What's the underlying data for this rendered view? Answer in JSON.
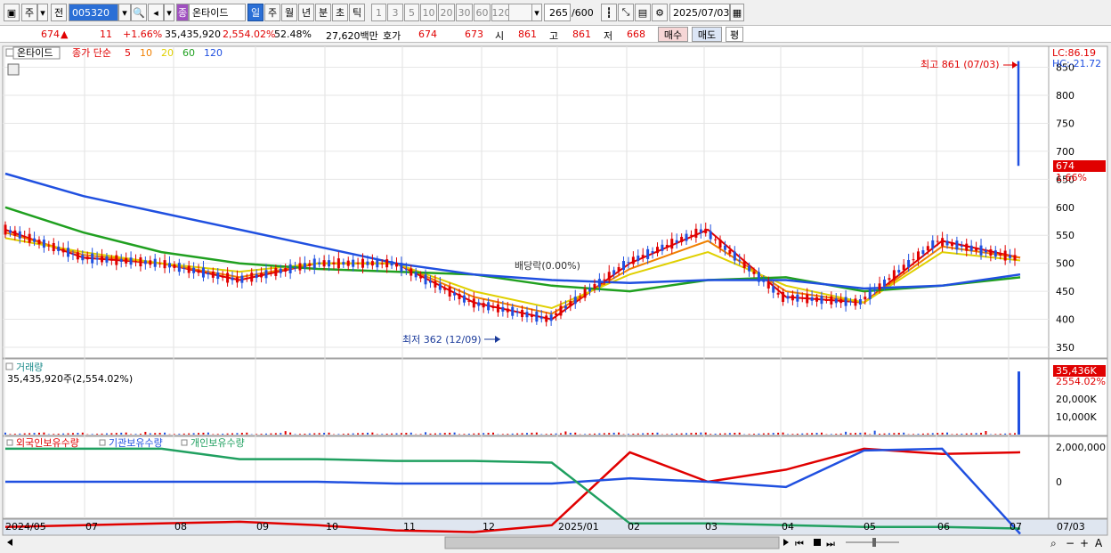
{
  "toolbar": {
    "market": "주",
    "type": "전",
    "code": "005320",
    "badge": "종",
    "name": "온타이드",
    "periods": [
      "일",
      "주",
      "월",
      "년",
      "분",
      "초",
      "틱"
    ],
    "selected_period": "일",
    "intervals": [
      "1",
      "3",
      "5",
      "10",
      "20",
      "30",
      "60",
      "120"
    ],
    "count": "265",
    "count_max": "/600",
    "date": "2025/07/03"
  },
  "quote": {
    "price": "674",
    "arrow": "▲",
    "change": "11",
    "change_pct": "+1.66%",
    "volume": "35,435,920",
    "volume_ratio": "2,554.02%",
    "turnover": "52.48%",
    "amount": "27,620백만",
    "hoga_label": "호가",
    "ask": "674",
    "bid": "673",
    "open_label": "시",
    "open": "861",
    "high_label": "고",
    "high": "861",
    "low_label": "저",
    "low": "668",
    "buy_label": "매수",
    "sell_label": "매도",
    "avg_label": "평"
  },
  "price_panel": {
    "name_tag": "온타이드",
    "legend_close": "종가 단순",
    "ma": [
      {
        "label": "5",
        "color": "#e00000"
      },
      {
        "label": "10",
        "color": "#f08000"
      },
      {
        "label": "20",
        "color": "#e0d000"
      },
      {
        "label": "60",
        "color": "#20a020"
      },
      {
        "label": "120",
        "color": "#2050e0"
      }
    ],
    "lc_label": "LC:86.19",
    "hc_label": "HC:-21.72",
    "axis_ticks": [
      "850",
      "800",
      "750",
      "700",
      "650",
      "600",
      "550",
      "500",
      "450",
      "400",
      "350"
    ],
    "high_annotation": "최고 861 (07/03)",
    "low_annotation": "최저 362 (12/09)",
    "dividend_annotation": "배당락(0.00%)",
    "last_price_box": "674",
    "last_pct": "1.66%"
  },
  "volume_panel": {
    "title": "거래량",
    "value_text": "35,435,920주(2,554.02%)",
    "box_value": "35,436K",
    "box_pct": "2554.02%",
    "axis_ticks": [
      "20,000K",
      "10,000K"
    ]
  },
  "holdings_panel": {
    "legend": [
      {
        "label": "외국인보유수량",
        "color": "#e00000"
      },
      {
        "label": "기관보유수량",
        "color": "#2050e0"
      },
      {
        "label": "개인보유수량",
        "color": "#20a060"
      }
    ],
    "axis_ticks": [
      "2,000,000",
      "0"
    ]
  },
  "x_axis": [
    "2024/05",
    "07",
    "08",
    "09",
    "10",
    "11",
    "12",
    "2025/01",
    "02",
    "03",
    "04",
    "05",
    "06",
    "07",
    "07/03"
  ],
  "colors": {
    "up": "#e00000",
    "down": "#2050e0",
    "accent": "#2b6fd6"
  },
  "chart_data": [
    {
      "type": "line",
      "title": "",
      "xlabel": "",
      "ylabel": "",
      "ylim": [
        330,
        870
      ],
      "categories": [
        "2024/05",
        "07",
        "08",
        "09",
        "10",
        "11",
        "12",
        "2025/01",
        "02",
        "03",
        "04",
        "05",
        "06",
        "07"
      ],
      "series": [
        {
          "name": "5",
          "values": [
            560,
            510,
            500,
            470,
            500,
            500,
            430,
            400,
            500,
            560,
            440,
            430,
            540,
            510
          ]
        },
        {
          "name": "10",
          "values": [
            555,
            515,
            500,
            475,
            500,
            500,
            440,
            410,
            490,
            540,
            450,
            430,
            530,
            510
          ]
        },
        {
          "name": "20",
          "values": [
            545,
            520,
            500,
            485,
            500,
            500,
            450,
            420,
            480,
            520,
            460,
            430,
            520,
            505
          ]
        },
        {
          "name": "60",
          "values": [
            600,
            555,
            520,
            500,
            490,
            485,
            480,
            460,
            450,
            470,
            475,
            450,
            460,
            475
          ]
        },
        {
          "name": "120",
          "values": [
            660,
            620,
            590,
            560,
            530,
            500,
            480,
            470,
            465,
            470,
            470,
            455,
            460,
            480
          ]
        }
      ],
      "annotations": {
        "high": 861,
        "low": 362,
        "last": 674
      }
    },
    {
      "type": "bar",
      "title": "거래량",
      "last_value": 35435920,
      "ylim": [
        0,
        36000000
      ]
    },
    {
      "type": "line",
      "series": [
        {
          "name": "외국인보유수량",
          "values": [
            -2600000,
            -2500000,
            -2400000,
            -2300000,
            -2500000,
            -2800000,
            -2900000,
            -2500000,
            1700000,
            0,
            700000,
            1900000,
            1600000,
            1700000
          ]
        },
        {
          "name": "기관보유수량",
          "values": [
            0,
            0,
            0,
            0,
            0,
            -100000,
            -100000,
            -100000,
            200000,
            0,
            -300000,
            1800000,
            1900000,
            -3000000
          ]
        },
        {
          "name": "개인보유수량",
          "values": [
            1900000,
            1900000,
            1900000,
            1300000,
            1300000,
            1200000,
            1200000,
            1100000,
            -2400000,
            -2400000,
            -2500000,
            -2600000,
            -2600000,
            -2700000
          ]
        }
      ],
      "ylim": [
        -3200000,
        2600000
      ]
    }
  ]
}
